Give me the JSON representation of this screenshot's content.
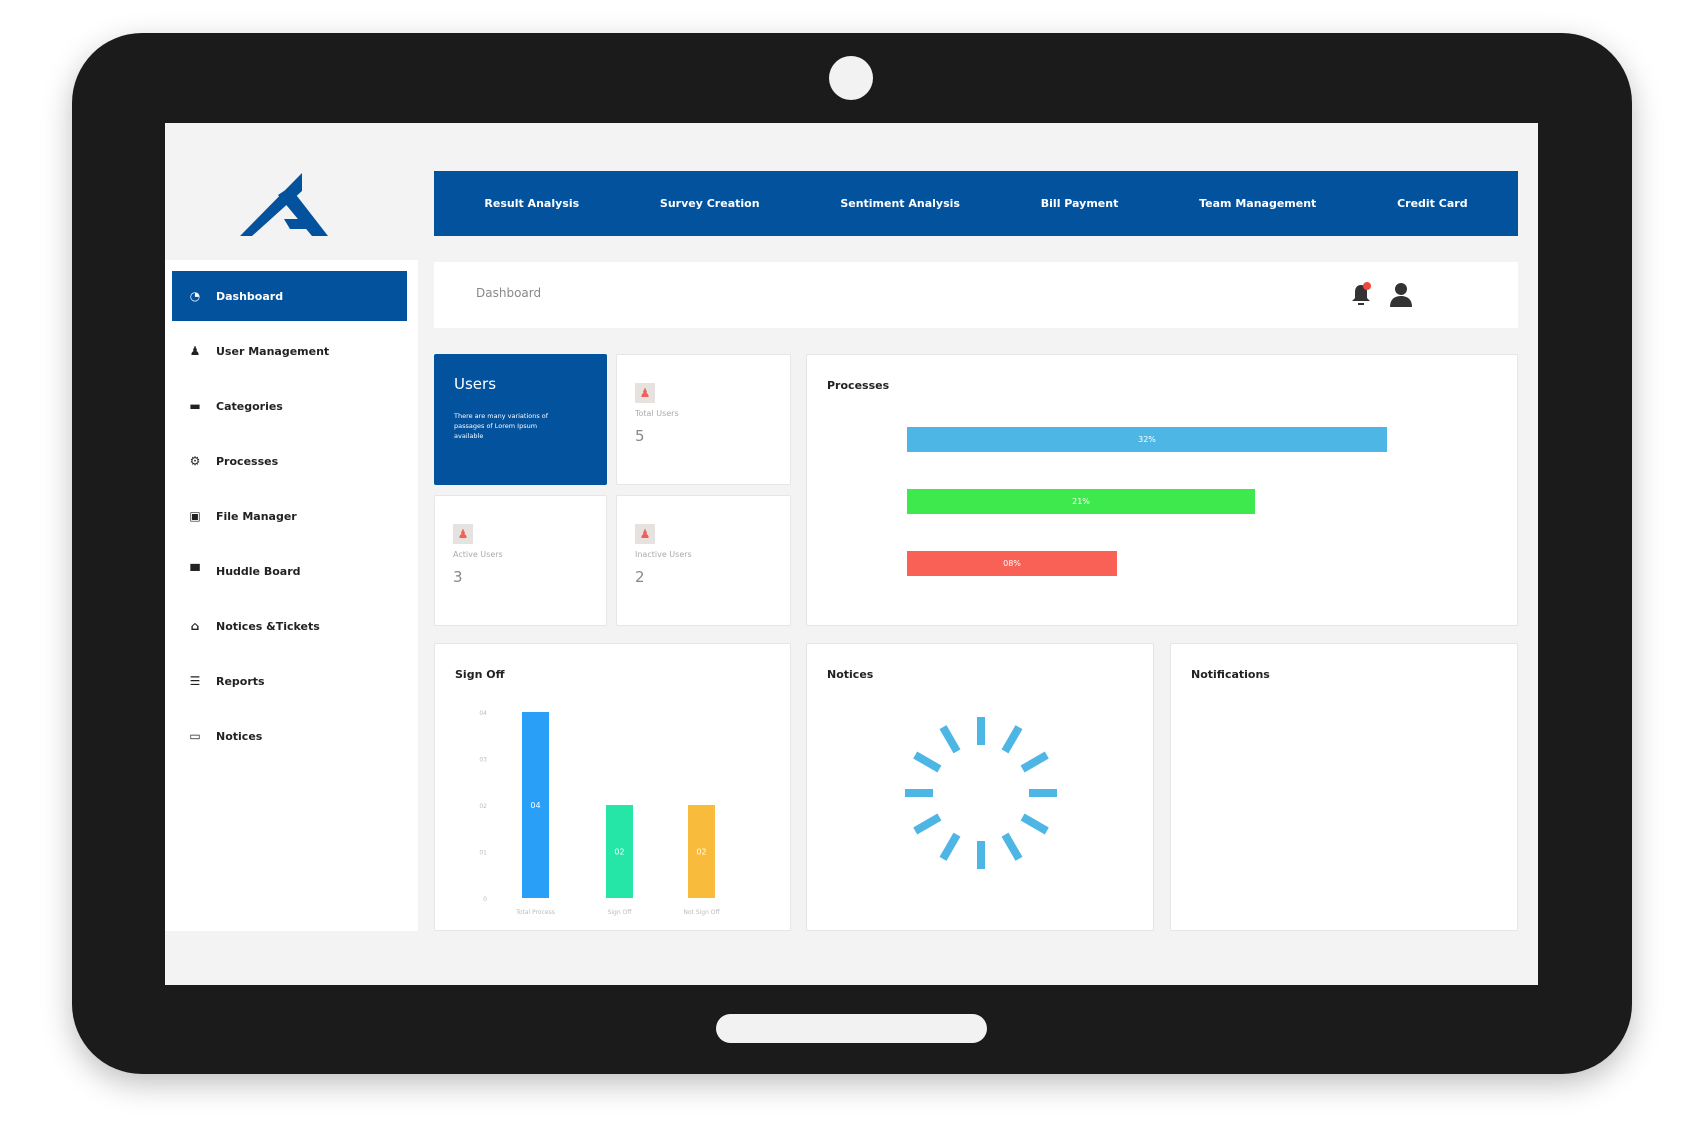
{
  "top_nav": [
    "Result Analysis",
    "Survey Creation",
    "Sentiment Analysis",
    "Bill Payment",
    "Team Management",
    "Credit Card"
  ],
  "sidebar": {
    "items": [
      {
        "label": "Dashboard",
        "icon": "gauge-icon",
        "glyph": "◔"
      },
      {
        "label": "User Management",
        "icon": "user-gear-icon",
        "glyph": "♟"
      },
      {
        "label": "Categories",
        "icon": "list-icon",
        "glyph": "▬"
      },
      {
        "label": "Processes",
        "icon": "gears-icon",
        "glyph": "⚙"
      },
      {
        "label": "File Manager",
        "icon": "file-icon",
        "glyph": "▣"
      },
      {
        "label": "Huddle Board",
        "icon": "board-icon",
        "glyph": "▀"
      },
      {
        "label": "Notices &Tickets",
        "icon": "clipboard-icon",
        "glyph": "⌂"
      },
      {
        "label": "Reports",
        "icon": "report-icon",
        "glyph": "☰"
      },
      {
        "label": "Notices",
        "icon": "notice-icon",
        "glyph": "▭"
      }
    ]
  },
  "header": {
    "breadcrumb": "Dashboard",
    "notification_count": "1"
  },
  "users_card": {
    "title": "Users",
    "description": "There are many variations of passages of Lorem Ipsum available"
  },
  "stats": [
    {
      "label": "Total Users",
      "value": "5"
    },
    {
      "label": "Active Users",
      "value": "3"
    },
    {
      "label": "Inactive Users",
      "value": "2"
    }
  ],
  "processes": {
    "title": "Processes",
    "bars": [
      {
        "label": "32%",
        "fill": 0.8,
        "color": "#4db6e4"
      },
      {
        "label": "21%",
        "fill": 0.58,
        "color": "#3ee94e"
      },
      {
        "label": "08%",
        "fill": 0.35,
        "color": "#f96157"
      }
    ]
  },
  "chart_data": {
    "type": "bar",
    "title": "Sign Off",
    "categories": [
      "Total Process",
      "Sign Off",
      "Not Sign Off"
    ],
    "values": [
      4,
      2,
      2
    ],
    "data_labels": [
      "04",
      "02",
      "02"
    ],
    "colors": [
      "#299ff7",
      "#26e6a7",
      "#f9bb3b"
    ],
    "ylim": [
      0,
      4
    ],
    "yticks": [
      "0",
      "01",
      "02",
      "03",
      "04"
    ]
  },
  "notices": {
    "title": "Notices"
  },
  "notifications": {
    "title": "Notifications"
  },
  "colors": {
    "brand": "#02529e",
    "spinner": "#4db6e4"
  }
}
